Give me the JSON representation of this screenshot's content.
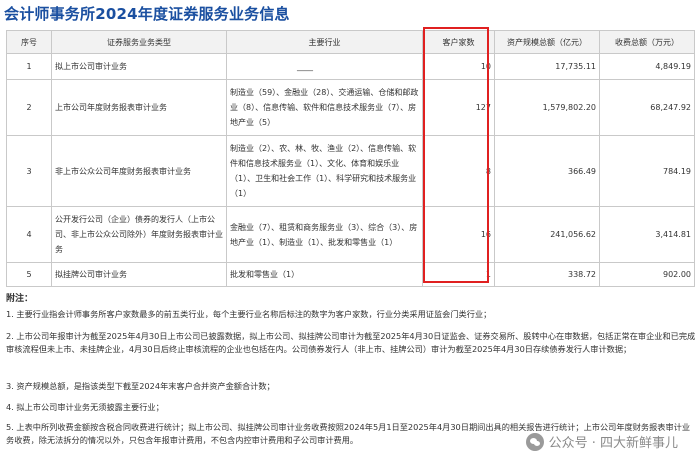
{
  "title": "会计师事务所2024年度证券服务业务信息",
  "table": {
    "headers": [
      "序号",
      "证券服务业务类型",
      "主要行业",
      "客户家数",
      "资产规模总额（亿元）",
      "收费总额（万元）"
    ],
    "rows": [
      {
        "no": "1",
        "type": "拟上市公司审计业务",
        "industry": "____",
        "clients": "10",
        "assets": "17,735.11",
        "fees": "4,849.19"
      },
      {
        "no": "2",
        "type": "上市公司年度财务报表审计业务",
        "industry": "制造业（59）、金融业（28）、交通运输、仓储和邮政业（8）、信息传输、软件和信息技术服务业（7）、房地产业（5）",
        "clients": "127",
        "assets": "1,579,802.20",
        "fees": "68,247.92"
      },
      {
        "no": "3",
        "type": "非上市公众公司年度财务报表审计业务",
        "industry": "制造业（2）、农、林、牧、渔业（2）、信息传输、软件和信息技术服务业（1）、文化、体育和娱乐业（1）、卫生和社会工作（1）、科学研究和技术服务业（1）",
        "clients": "8",
        "assets": "366.49",
        "fees": "784.19"
      },
      {
        "no": "4",
        "type": "公开发行公司（企业）债券的发行人（上市公司、非上市公众公司除外）年度财务报表审计业务",
        "industry": "金融业（7）、租赁和商务服务业（3）、综合（3）、房地产业（1）、制造业（1）、批发和零售业（1）",
        "clients": "16",
        "assets": "241,056.62",
        "fees": "3,414.81"
      },
      {
        "no": "5",
        "type": "拟挂牌公司审计业务",
        "industry": "批发和零售业（1）",
        "clients": "1",
        "assets": "338.72",
        "fees": "902.00"
      }
    ]
  },
  "notes": {
    "title": "附注：",
    "items": [
      "1. 主要行业指会计师事务所客户家数最多的前五类行业，每个主要行业名称后标注的数字为客户家数，行业分类采用证监会门类行业；",
      "2. 上市公司年报审计为截至2025年4月30日上市公司已披露数据，拟上市公司、拟挂牌公司审计为截至2025年4月30日证监会、证券交易所、股转中心在审数据，包括正常在审企业和已完成审核流程但未上市、未挂牌企业，4月30日后终止审核流程的企业也包括在内。公司债券发行人（非上市、挂牌公司）审计为截至2025年4月30日存续债券发行人审计数据；",
      "3. 资产规模总额，是指该类型下截至2024年末客户合并资产金额合计数；",
      "4. 拟上市公司审计业务无须披露主要行业；",
      "5. 上表中所列收费金额按含税合同收费进行统计；拟上市公司、拟挂牌公司审计业务收费按照2024年5月1日至2025年4月30日期间出具的相关报告进行统计；上市公司年度财务报表审计业务收费，除无法拆分的情况以外，只包含年报审计费用，不包含内控审计费用和子公司审计费用。"
    ]
  },
  "watermark": "公众号 · 四大新鲜事儿"
}
